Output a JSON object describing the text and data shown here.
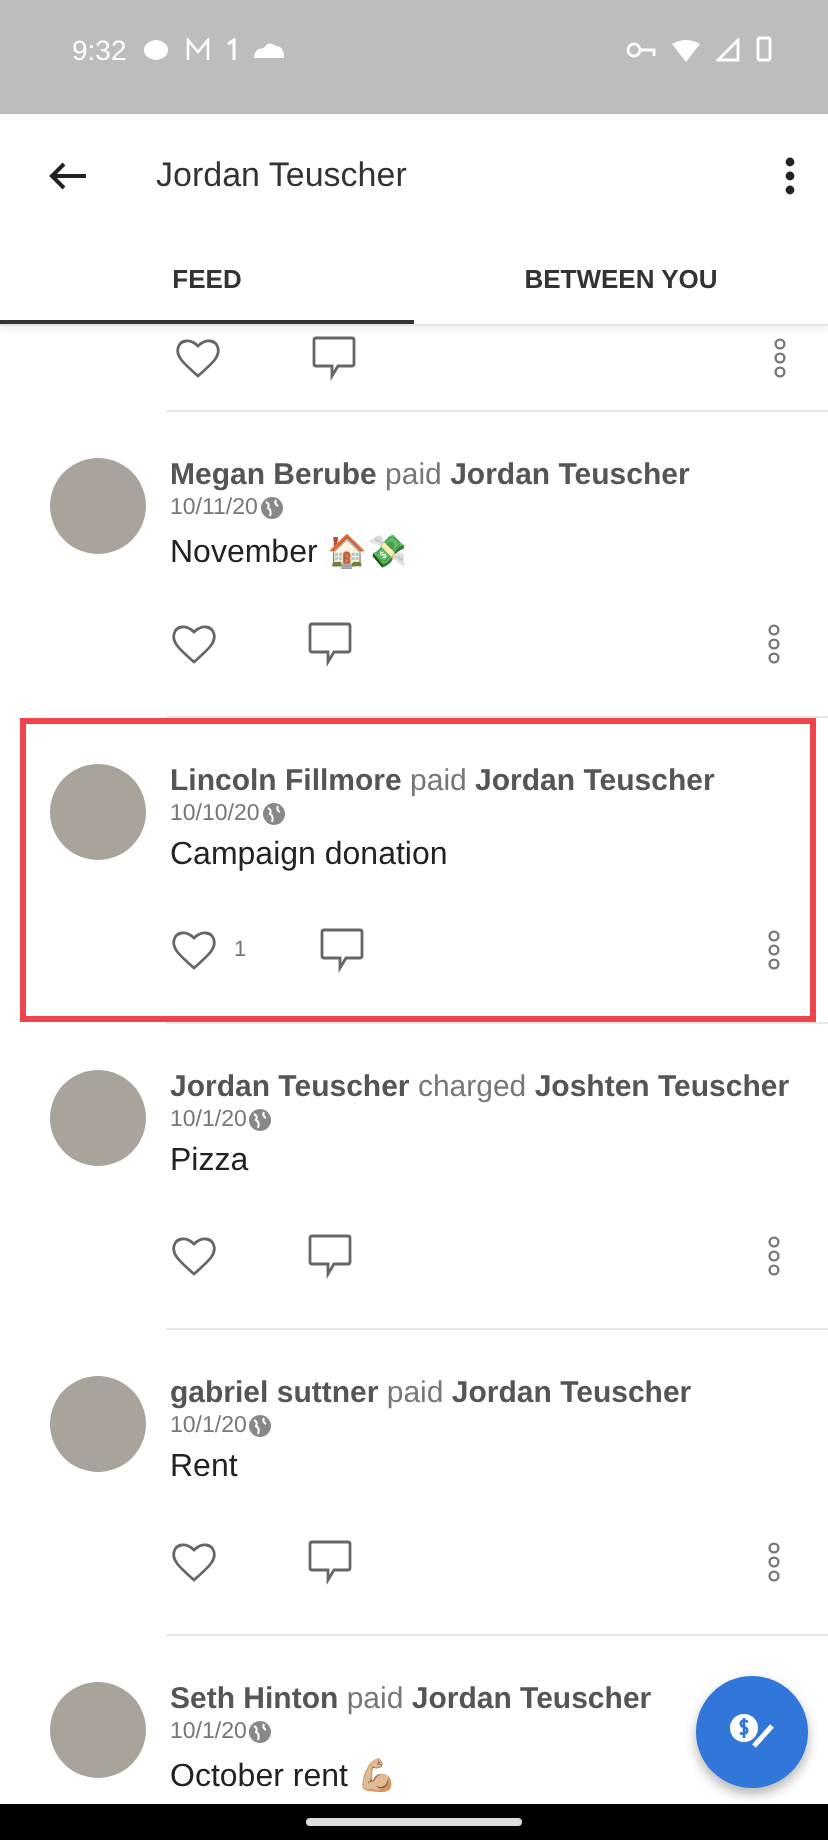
{
  "status_bar": {
    "time": "9:32"
  },
  "header": {
    "title": "Jordan Teuscher"
  },
  "tabs": [
    {
      "label": "FEED",
      "selected": true
    },
    {
      "label": "BETWEEN YOU",
      "selected": false
    }
  ],
  "posts": [
    {
      "actor": "Megan Berube",
      "verb": "paid",
      "target": "Jordan Teuscher",
      "date": "10/11/20",
      "note": "November 🏠💸",
      "highlighted": false
    },
    {
      "actor": "Lincoln Fillmore",
      "verb": "paid",
      "target": "Jordan Teuscher",
      "date": "10/10/20",
      "note": "Campaign donation",
      "likes": "1",
      "highlighted": true
    },
    {
      "actor": "Jordan Teuscher",
      "verb": "charged",
      "target": "Joshten Teuscher",
      "date": "10/1/20",
      "note": "Pizza",
      "highlighted": false
    },
    {
      "actor": "gabriel suttner",
      "verb": "paid",
      "target": "Jordan Teuscher",
      "date": "10/1/20",
      "note": "Rent",
      "highlighted": false
    },
    {
      "actor": "Seth Hinton",
      "verb": "paid",
      "target": "Jordan Teuscher",
      "date": "10/1/20",
      "note": "October rent 💪🏼",
      "highlighted": false
    }
  ]
}
